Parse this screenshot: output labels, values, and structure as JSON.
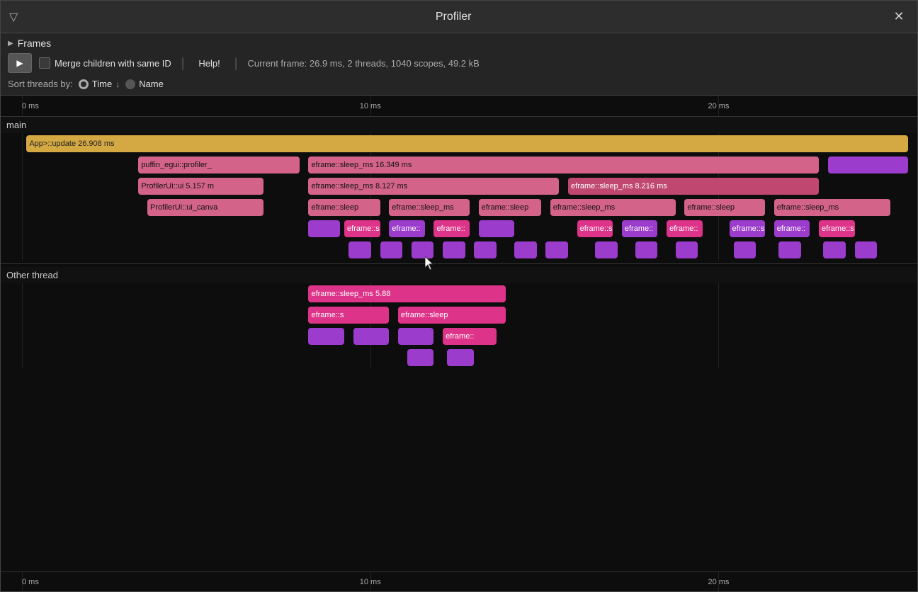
{
  "window": {
    "title": "Profiler"
  },
  "toolbar": {
    "frames_label": "Frames",
    "merge_label": "Merge children with same ID",
    "help_label": "Help!",
    "status": "Current frame: 26.9 ms, 2 threads, 1040 scopes, 49.2 kB",
    "sort_label": "Sort threads by:",
    "sort_time": "Time",
    "sort_name": "Name"
  },
  "timeline": {
    "top_ticks": [
      "0 ms",
      "10 ms",
      "20 ms"
    ],
    "bottom_ticks": [
      "0 ms",
      "10 ms",
      "20 ms"
    ],
    "threads": [
      {
        "name": "main"
      },
      {
        "name": "Other thread"
      }
    ]
  },
  "colors": {
    "yellow": "#d4a843",
    "pink": "#d4638a",
    "hot_pink": "#dd3388",
    "purple": "#9b3ccc",
    "bright_pink": "#e040a0",
    "red_pink": "#c04870"
  },
  "flame_bars": {
    "main_row0": [
      {
        "label": "App>::update 26.908 ms",
        "left_pct": 0.5,
        "width_pct": 98,
        "color": "yellow"
      }
    ],
    "main_row1": [
      {
        "label": "puffin_egui::profiler_",
        "left_pct": 13,
        "width_pct": 18,
        "color": "pink"
      },
      {
        "label": "eframe::sleep_ms 16.349 ms",
        "left_pct": 32,
        "width_pct": 57,
        "color": "pink"
      },
      {
        "label": "",
        "left_pct": 90,
        "width_pct": 9,
        "color": "purple"
      }
    ],
    "main_row2": [
      {
        "label": "ProfilerUi::ui  5.157 m",
        "left_pct": 13,
        "width_pct": 14,
        "color": "pink"
      },
      {
        "label": "eframe::sleep_ms  8.127 ms",
        "left_pct": 32,
        "width_pct": 28,
        "color": "pink"
      },
      {
        "label": "eframe::sleep_ms  8.216 ms",
        "left_pct": 61,
        "width_pct": 28,
        "color": "red_pink"
      }
    ],
    "main_row3": [
      {
        "label": "ProfilerUi::ui_canva",
        "left_pct": 14,
        "width_pct": 13,
        "color": "pink"
      },
      {
        "label": "eframe::sleep",
        "left_pct": 32,
        "width_pct": 9,
        "color": "pink"
      },
      {
        "label": "eframe::sleep_ms",
        "left_pct": 42,
        "width_pct": 9,
        "color": "pink"
      },
      {
        "label": "eframe::sleep",
        "left_pct": 52,
        "width_pct": 7,
        "color": "pink"
      },
      {
        "label": "eframe::sleep_ms",
        "left_pct": 61,
        "width_pct": 14,
        "color": "pink"
      },
      {
        "label": "eframe::sleep",
        "left_pct": 76,
        "width_pct": 9,
        "color": "pink"
      },
      {
        "label": "eframe::sleep_ms",
        "left_pct": 86,
        "width_pct": 13,
        "color": "pink"
      }
    ],
    "main_row4": [
      {
        "label": "",
        "left_pct": 32,
        "width_pct": 4,
        "color": "purple"
      },
      {
        "label": "eframe::s",
        "left_pct": 37,
        "width_pct": 4,
        "color": "hot_pink"
      },
      {
        "label": "eframe::",
        "left_pct": 42,
        "width_pct": 4,
        "color": "purple"
      },
      {
        "label": "eframe::",
        "left_pct": 47,
        "width_pct": 4,
        "color": "hot_pink"
      },
      {
        "label": "",
        "left_pct": 52,
        "width_pct": 4,
        "color": "purple"
      },
      {
        "label": "eframe::s",
        "left_pct": 63,
        "width_pct": 4,
        "color": "hot_pink"
      },
      {
        "label": "eframe::",
        "left_pct": 68,
        "width_pct": 4,
        "color": "purple"
      },
      {
        "label": "eframe::",
        "left_pct": 74,
        "width_pct": 4,
        "color": "hot_pink"
      },
      {
        "label": "eframe::s",
        "left_pct": 80,
        "width_pct": 4,
        "color": "purple"
      },
      {
        "label": "eframe::",
        "left_pct": 86,
        "width_pct": 4,
        "color": "purple"
      },
      {
        "label": "eframe::s",
        "left_pct": 91,
        "width_pct": 4,
        "color": "hot_pink"
      }
    ],
    "main_row5": [
      {
        "label": "",
        "left_pct": 37,
        "width_pct": 3,
        "color": "purple"
      },
      {
        "label": "",
        "left_pct": 41,
        "width_pct": 3,
        "color": "purple"
      },
      {
        "label": "",
        "left_pct": 45,
        "width_pct": 3,
        "color": "purple"
      },
      {
        "label": "",
        "left_pct": 49,
        "width_pct": 3,
        "color": "purple"
      },
      {
        "label": "",
        "left_pct": 53,
        "width_pct": 3,
        "color": "purple"
      },
      {
        "label": "",
        "left_pct": 57,
        "width_pct": 3,
        "color": "purple"
      },
      {
        "label": "",
        "left_pct": 61,
        "width_pct": 3,
        "color": "purple"
      },
      {
        "label": "",
        "left_pct": 66,
        "width_pct": 3,
        "color": "purple"
      },
      {
        "label": "",
        "left_pct": 71,
        "width_pct": 3,
        "color": "purple"
      },
      {
        "label": "",
        "left_pct": 76,
        "width_pct": 3,
        "color": "purple"
      },
      {
        "label": "",
        "left_pct": 81,
        "width_pct": 3,
        "color": "purple"
      },
      {
        "label": "",
        "left_pct": 86,
        "width_pct": 3,
        "color": "purple"
      },
      {
        "label": "",
        "left_pct": 91,
        "width_pct": 3,
        "color": "purple"
      },
      {
        "label": "",
        "left_pct": 95,
        "width_pct": 3,
        "color": "purple"
      }
    ],
    "other_row0": [
      {
        "label": "eframe::sleep_ms  5.88",
        "left_pct": 32,
        "width_pct": 22,
        "color": "hot_pink"
      }
    ],
    "other_row1": [
      {
        "label": "eframe::s",
        "left_pct": 32,
        "width_pct": 9,
        "color": "hot_pink"
      },
      {
        "label": "eframe::sleep",
        "left_pct": 42,
        "width_pct": 12,
        "color": "hot_pink"
      }
    ],
    "other_row2": [
      {
        "label": "",
        "left_pct": 32,
        "width_pct": 4,
        "color": "purple"
      },
      {
        "label": "",
        "left_pct": 37,
        "width_pct": 4,
        "color": "purple"
      },
      {
        "label": "",
        "left_pct": 42,
        "width_pct": 5,
        "color": "purple"
      },
      {
        "label": "eframe::",
        "left_pct": 48,
        "width_pct": 6,
        "color": "hot_pink"
      }
    ],
    "other_row3": [
      {
        "label": "",
        "left_pct": 44,
        "width_pct": 4,
        "color": "purple"
      },
      {
        "label": "",
        "left_pct": 49,
        "width_pct": 4,
        "color": "purple"
      }
    ]
  }
}
